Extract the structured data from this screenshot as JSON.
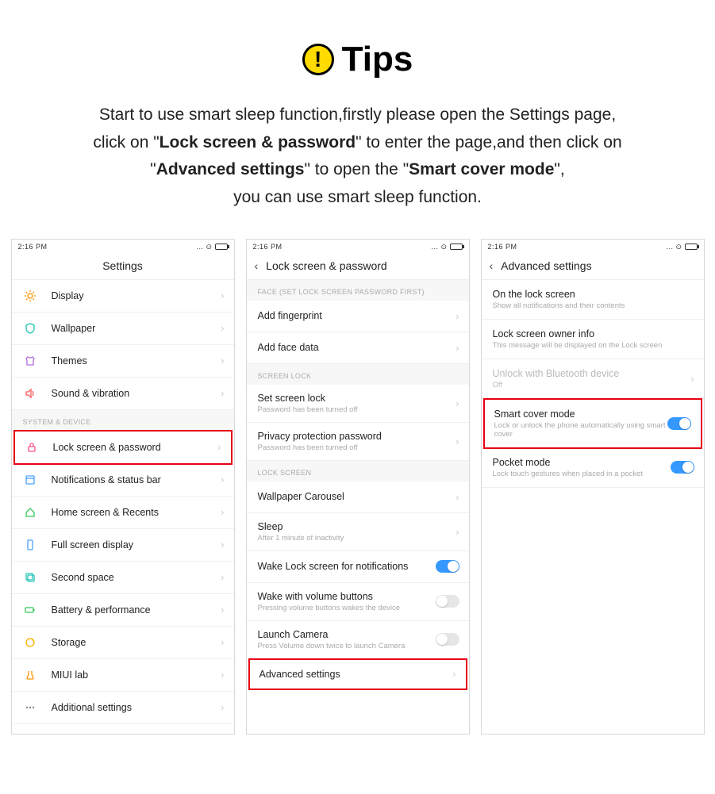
{
  "header": {
    "title": "Tips",
    "body_parts": [
      "Start to use smart sleep function,firstly please open the Settings page,",
      "click on \"",
      "Lock screen & password",
      "\" to enter the page,and then click on",
      "\"",
      "Advanced settings",
      "\" to open the \"",
      "Smart cover mode",
      "\",",
      "you can use smart sleep function."
    ]
  },
  "statusbar": {
    "time": "2:16 PM",
    "dots": "...",
    "chat": "⊙"
  },
  "screen1": {
    "title": "Settings",
    "items": [
      {
        "label": "Display"
      },
      {
        "label": "Wallpaper"
      },
      {
        "label": "Themes"
      },
      {
        "label": "Sound & vibration"
      }
    ],
    "section": "SYSTEM & DEVICE",
    "items2": [
      {
        "label": "Lock screen & password",
        "highlight": true
      },
      {
        "label": "Notifications & status bar"
      },
      {
        "label": "Home screen & Recents"
      },
      {
        "label": "Full screen display"
      },
      {
        "label": "Second space"
      },
      {
        "label": "Battery & performance"
      },
      {
        "label": "Storage"
      },
      {
        "label": "MIUI lab"
      },
      {
        "label": "Additional settings"
      }
    ]
  },
  "screen2": {
    "title": "Lock screen & password",
    "sectionA": "FACE (SET LOCK SCREEN PASSWORD FIRST)",
    "itemsA": [
      {
        "label": "Add fingerprint"
      },
      {
        "label": "Add face data"
      }
    ],
    "sectionB": "SCREEN LOCK",
    "itemsB": [
      {
        "label": "Set screen lock",
        "sub": "Password has been turned off"
      },
      {
        "label": "Privacy protection password",
        "sub": "Password has been turned off"
      }
    ],
    "sectionC": "LOCK SCREEN",
    "itemsC": [
      {
        "label": "Wallpaper Carousel"
      },
      {
        "label": "Sleep",
        "sub": "After 1 minute of inactivity"
      },
      {
        "label": "Wake Lock screen for notifications",
        "toggle": "on"
      },
      {
        "label": "Wake with volume buttons",
        "sub": "Pressing volume buttons wakes the device",
        "toggle": "off"
      },
      {
        "label": "Launch Camera",
        "sub": "Press Volume down twice to launch Camera",
        "toggle": "off"
      },
      {
        "label": "Advanced settings",
        "highlight": true
      }
    ]
  },
  "screen3": {
    "title": "Advanced  settings",
    "items": [
      {
        "label": "On the lock screen",
        "sub": "Show all notifications and their contents"
      },
      {
        "label": "Lock screen owner info",
        "sub": "This message will be displayed on the Lock screen"
      },
      {
        "label": "Unlock with Bluetooth device",
        "sub": "Off",
        "disabled": true
      },
      {
        "label": "Smart cover mode",
        "sub": "Lock or unlock the phone automatically using smart cover",
        "toggle": "on",
        "highlight": true
      },
      {
        "label": "Pocket mode",
        "sub": "Lock touch gestures when placed in a pocket",
        "toggle": "on"
      }
    ]
  }
}
